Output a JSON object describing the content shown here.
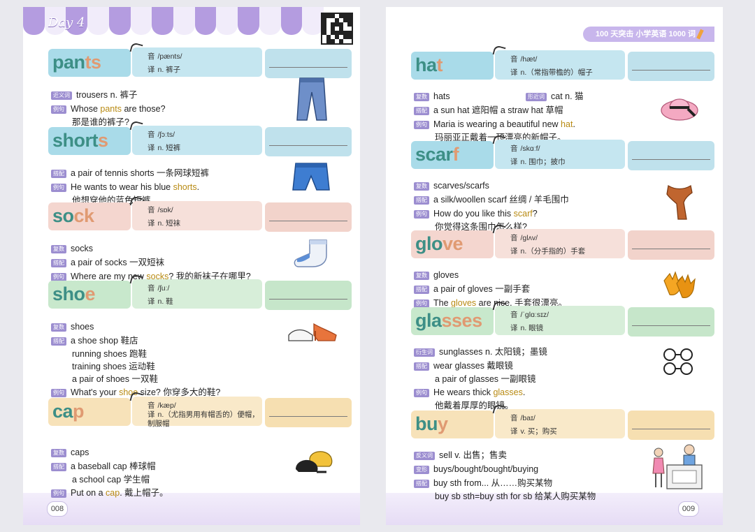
{
  "left_page": {
    "day_label": "Day 4",
    "page_number": "008",
    "entries": [
      {
        "word_a": "pan",
        "word_b": "ts",
        "ipa_tag": "音",
        "ipa": "/pænts/",
        "tr_tag": "译",
        "translation": "n. 裤子",
        "lines": [
          {
            "tag": "近义词",
            "text": "trousers n. 裤子"
          },
          {
            "tag": "例句",
            "pre": "Whose ",
            "hl": "pants",
            "post": " are those?"
          },
          {
            "tag": "",
            "text": "那是谁的裤子?"
          }
        ]
      },
      {
        "word_a": "short",
        "word_b": "s",
        "ipa_tag": "音",
        "ipa": "/ʃɔːts/",
        "tr_tag": "译",
        "translation": "n. 短裤",
        "lines": [
          {
            "tag": "搭配",
            "text": "a pair of tennis shorts 一条网球短裤"
          },
          {
            "tag": "例句",
            "pre": "He wants to wear his blue ",
            "hl": "shorts",
            "post": "."
          },
          {
            "tag": "",
            "text": "他想穿他的蓝色短裤。"
          }
        ]
      },
      {
        "word_a": "so",
        "word_b": "ck",
        "ipa_tag": "音",
        "ipa": "/sɒk/",
        "tr_tag": "译",
        "translation": "n. 短袜",
        "lines": [
          {
            "tag": "复数",
            "text": "socks"
          },
          {
            "tag": "搭配",
            "text": "a pair of socks 一双短袜"
          },
          {
            "tag": "例句",
            "pre": "Where are my new ",
            "hl": "socks",
            "post": "? 我的新袜子在哪里?"
          }
        ]
      },
      {
        "word_a": "sho",
        "word_b": "e",
        "ipa_tag": "音",
        "ipa": "/ʃuː/",
        "tr_tag": "译",
        "translation": "n. 鞋",
        "lines": [
          {
            "tag": "复数",
            "text": "shoes"
          },
          {
            "tag": "搭配",
            "text": "a shoe shop 鞋店"
          },
          {
            "tag": "",
            "text": "running shoes 跑鞋"
          },
          {
            "tag": "",
            "text": "training shoes 运动鞋"
          },
          {
            "tag": "",
            "text": "a pair of shoes 一双鞋"
          },
          {
            "tag": "例句",
            "pre": "What's your ",
            "hl": "shoe",
            "post": " size? 你穿多大的鞋?"
          }
        ]
      },
      {
        "word_a": "ca",
        "word_b": "p",
        "ipa_tag": "音",
        "ipa": "/kæp/",
        "tr_tag": "译",
        "translation": "n.（尤指男用有帽舌的）便帽，制服帽",
        "lines": [
          {
            "tag": "复数",
            "text": "caps"
          },
          {
            "tag": "搭配",
            "text": "a baseball cap 棒球帽"
          },
          {
            "tag": "",
            "text": "a school cap 学生帽"
          },
          {
            "tag": "例句",
            "pre": "Put on a ",
            "hl": "cap",
            "post": ". 戴上帽子。"
          }
        ]
      }
    ]
  },
  "right_page": {
    "header": "100 天突击 小学英语 1000 词",
    "page_number": "009",
    "entries": [
      {
        "word_a": "ha",
        "word_b": "t",
        "ipa_tag": "音",
        "ipa": "/hæt/",
        "tr_tag": "译",
        "translation": "n.（常指带檐的）帽子",
        "extra_tag": "形近词",
        "extra_text": "cat n. 猫",
        "lines": [
          {
            "tag": "复数",
            "text": "hats"
          },
          {
            "tag": "搭配",
            "text": "a sun hat 遮阳帽          a straw hat 草帽"
          },
          {
            "tag": "例句",
            "pre": "Maria is wearing a beautiful new ",
            "hl": "hat",
            "post": "."
          },
          {
            "tag": "",
            "text": "玛丽亚正戴着一顶漂亮的新帽子。"
          }
        ]
      },
      {
        "word_a": "scar",
        "word_b": "f",
        "ipa_tag": "音",
        "ipa": "/skɑːf/",
        "tr_tag": "译",
        "translation": "n. 围巾；披巾",
        "lines": [
          {
            "tag": "复数",
            "text": "scarves/scarfs"
          },
          {
            "tag": "搭配",
            "text": "a silk/woollen scarf 丝绸 / 羊毛围巾"
          },
          {
            "tag": "例句",
            "pre": "How do you like this ",
            "hl": "scarf",
            "post": "?"
          },
          {
            "tag": "",
            "text": "你觉得这条围巾怎么样?"
          }
        ]
      },
      {
        "word_a": "glo",
        "word_b": "ve",
        "ipa_tag": "音",
        "ipa": "/ɡlʌv/",
        "tr_tag": "译",
        "translation": "n.（分手指的）手套",
        "lines": [
          {
            "tag": "复数",
            "text": "gloves"
          },
          {
            "tag": "搭配",
            "text": "a pair of gloves 一副手套"
          },
          {
            "tag": "例句",
            "pre": "The ",
            "hl": "gloves",
            "post": " are nice. 手套很漂亮。"
          }
        ]
      },
      {
        "word_a": "gla",
        "word_b": "sses",
        "ipa_tag": "音",
        "ipa": "/ˈɡlɑːsɪz/",
        "tr_tag": "译",
        "translation": "n. 眼镜",
        "lines": [
          {
            "tag": "衍生词",
            "text": "sunglasses n. 太阳镜；墨镜"
          },
          {
            "tag": "搭配",
            "text": "wear glasses 戴眼镜"
          },
          {
            "tag": "",
            "text": "a pair of glasses 一副眼镜"
          },
          {
            "tag": "例句",
            "pre": "He wears thick ",
            "hl": "glasses",
            "post": "."
          },
          {
            "tag": "",
            "text": "他戴着厚厚的眼镜。"
          }
        ]
      },
      {
        "word_a": "bu",
        "word_b": "y",
        "ipa_tag": "音",
        "ipa": "/baɪ/",
        "tr_tag": "译",
        "translation": "v. 买；购买",
        "lines": [
          {
            "tag": "反义词",
            "text": "sell v. 出售；售卖"
          },
          {
            "tag": "变形",
            "text": "buys/bought/bought/buying"
          },
          {
            "tag": "搭配",
            "text": "buy sth from... 从……购买某物"
          },
          {
            "tag": "",
            "text": "buy sb sth=buy sth for sb 给某人购买某物"
          }
        ]
      }
    ]
  },
  "colors": {
    "teal": "#3d8f86",
    "peach": "#e09a72",
    "accent": "#b49ce0",
    "highlight": "#b88a12"
  }
}
